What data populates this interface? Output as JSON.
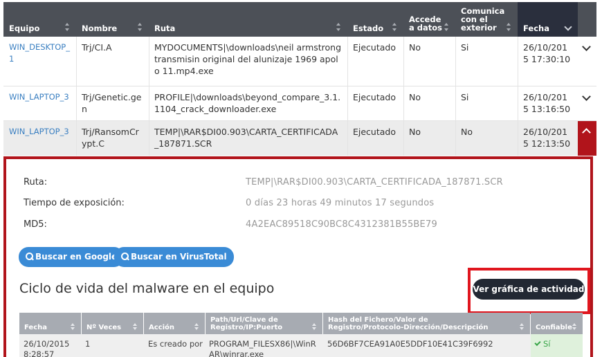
{
  "table": {
    "columns": [
      "Equipo",
      "Nombre",
      "Ruta",
      "Estado",
      "Accede a datos",
      "Comunica con el exterior",
      "Fecha"
    ],
    "rows": [
      {
        "equipo": "WIN_DESKTOP_1",
        "nombre": "Trj/CI.A",
        "ruta": "MYDOCUMENTS|\\downloads\\neil armstrong transmisin original del alunizaje 1969 apolo 11.mp4.exe",
        "estado": "Ejecutado",
        "accede": "No",
        "comunica": "Si",
        "fecha": "26/10/2015 17:30:10"
      },
      {
        "equipo": "WIN_LAPTOP_3",
        "nombre": "Trj/Genetic.gen",
        "ruta": "PROFILE|\\downloads\\beyond_compare_3.1.1104_crack_downloader.exe",
        "estado": "Ejecutado",
        "accede": "No",
        "comunica": "Si",
        "fecha": "26/10/2015 13:16:50"
      },
      {
        "equipo": "WIN_LAPTOP_3",
        "nombre": "Trj/RansomCrypt.C",
        "ruta": "TEMP|\\RAR$DI00.903\\CARTA_CERTIFICADA_187871.SCR",
        "estado": "Ejecutado",
        "accede": "No",
        "comunica": "No",
        "fecha": "26/10/2015 12:13:50"
      }
    ]
  },
  "detail": {
    "ruta_label": "Ruta:",
    "ruta_value": "TEMP|\\RAR$DI00.903\\CARTA_CERTIFICADA_187871.SCR",
    "tiempo_label": "Tiempo de exposición:",
    "tiempo_value": "0 días 23 horas 49 minutos 17 segundos",
    "md5_label": "MD5:",
    "md5_value": "4A2EAC89518C90BC8C4312381B55BE79",
    "google_button": "Buscar en Google",
    "virustotal_button": "Buscar en VirusTotal",
    "lifecycle_title": "Ciclo de vida del malware en el equipo",
    "activity_button": "Ver gráfica de actividad"
  },
  "lifecycle": {
    "columns": [
      "Fecha",
      "Nº Veces",
      "Acción",
      "Path/Url/Clave de Registro/IP:Puerto",
      "Hash del Fichero/Valor de Registro/Protocolo-Dirección/Descripción",
      "Confiable"
    ],
    "rows": [
      {
        "fecha": "26/10/2015 8:28:57",
        "veces": "1",
        "accion": "Es creado por",
        "path": "PROGRAM_FILESX86|\\WinRAR\\winrar.exe",
        "hash": "56D6BF7CEA91A0E5DDF10E41C39F6992",
        "confiable": "Sí"
      }
    ]
  },
  "colors": {
    "accent_red": "#b1141b",
    "header_dark": "#4c5057",
    "link_blue": "#3a7fc1",
    "button_blue": "#3a8bd6",
    "ok_green": "#3aa64a"
  }
}
